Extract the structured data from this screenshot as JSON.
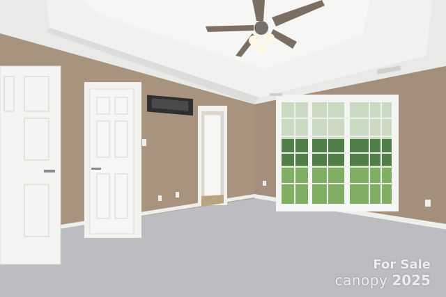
{
  "watermark": {
    "line1": "For Sale",
    "brand": "canopy",
    "year": "2025"
  },
  "colors": {
    "wall": "#a8937f",
    "ceiling": "#eeeeec",
    "carpet": "#bdbcc0",
    "door": "#f4f4f2",
    "window_glass": "#6f9a5f",
    "trim": "#f2f1ee"
  }
}
